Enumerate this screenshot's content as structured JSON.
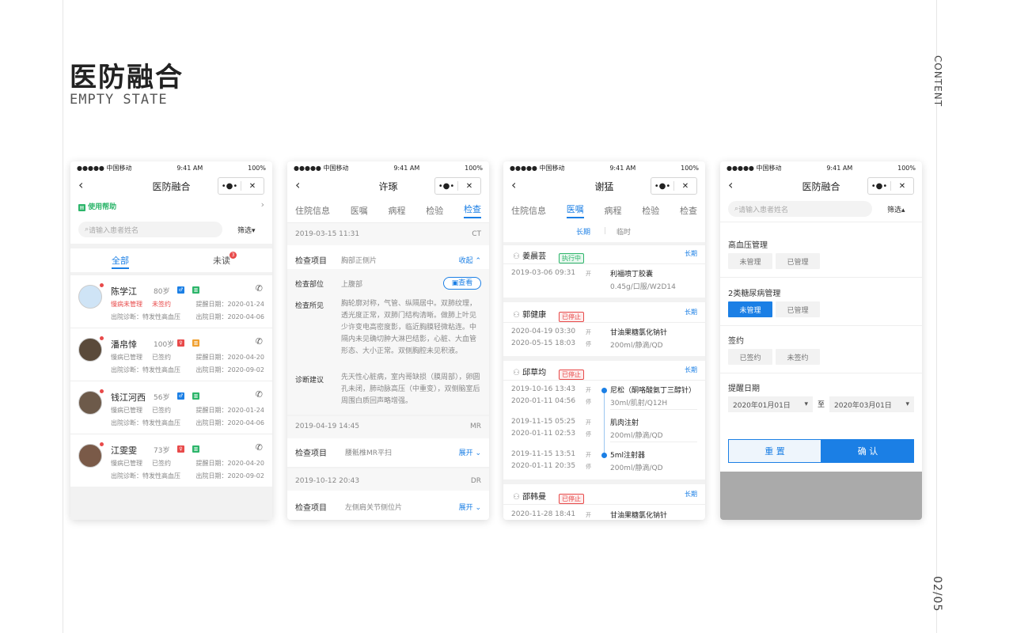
{
  "page": {
    "title": "医防融合",
    "subtitle": "EMPTY STATE",
    "side_top": "CONTENT",
    "side_bottom": "02/05"
  },
  "status": {
    "carrier": "●●●●● 中国移动",
    "time": "9:41 AM",
    "battery": "100%"
  },
  "colors": {
    "brand": "#1b7fe5",
    "green": "#2cb56a",
    "red": "#e84a4a"
  },
  "s1": {
    "nav_title": "医防融合",
    "help": "使用帮助",
    "search_placeholder": "请输入患者姓名",
    "filter": "筛选▾",
    "tab_all": "全部",
    "tab_unread": "未读",
    "unread_count": "3",
    "patients": [
      {
        "name": "陈学江",
        "age": "80岁",
        "tag1": "慢病未管理",
        "tag2": "未签约",
        "remind": "提醒日期：2020-01-24",
        "diag": "出院诊断：特发性高血压",
        "out": "出院日期：2020-04-06",
        "sex": "♂",
        "sexcolor": "#1b7fe5"
      },
      {
        "name": "潘帛悻",
        "age": "100岁",
        "tag1": "慢病已管理",
        "tag2": "已签约",
        "remind": "提醒日期：2020-04-20",
        "diag": "出院诊断：特发性高血压",
        "out": "出院日期：2020-09-02",
        "sex": "♀",
        "sexcolor": "#e84a4a"
      },
      {
        "name": "钱江河西",
        "age": "56岁",
        "tag1": "慢病已管理",
        "tag2": "已签约",
        "remind": "提醒日期：2020-01-24",
        "diag": "出院诊断：特发性高血压",
        "out": "出院日期：2020-04-06",
        "sex": "♂",
        "sexcolor": "#1b7fe5"
      },
      {
        "name": "江雯雯",
        "age": "73岁",
        "tag1": "慢病已管理",
        "tag2": "已签约",
        "remind": "提醒日期：2020-04-20",
        "diag": "出院诊断：特发性高血压",
        "out": "出院日期：2020-09-02",
        "sex": "♀",
        "sexcolor": "#e84a4a"
      }
    ]
  },
  "s2": {
    "nav_title": "许琢",
    "tabs": [
      "住院信息",
      "医嘱",
      "病程",
      "检验",
      "检查"
    ],
    "rec1": {
      "date": "2019-03-15  11:31",
      "type": "CT",
      "item_label": "检查项目",
      "item": "胸部正侧片",
      "collapse": "收起",
      "part_label": "检查部位",
      "part": "上腹部",
      "view": "查看",
      "find_label": "检查所见",
      "find": "胸轮廓对称，气管、纵隔居中。双肺纹理，透光度正常，双肺门结构清晰。做肺上叶见少许变电高密度影，临近胸膜轻微粘连。中隔内未见确切肿大淋巴结影，心脏、大血管形态、大小正常。双侧胸腔未见积液。",
      "advice_label": "诊断建议",
      "advice": "先天性心脏病，室内哥缺损（膜周部），卵圆孔未闭，肺动脉高压（中重变），双侧脑室后周围白质回声略增强。"
    },
    "rec2": {
      "date": "2019-04-19  14:45",
      "type": "MR",
      "item_label": "检查项目",
      "item": "腰骶椎MR平扫",
      "expand": "展开"
    },
    "rec3": {
      "date": "2019-10-12  20:43",
      "type": "DR",
      "item_label": "检查项目",
      "item": "左侧肩关节侧位片",
      "expand": "展开"
    }
  },
  "s3": {
    "nav_title": "谢猛",
    "tabs": [
      "住院信息",
      "医嘱",
      "病程",
      "检验",
      "检查"
    ],
    "sub_long": "长期",
    "sub_temp": "临时",
    "g1": {
      "name": "姜晨芸",
      "status": "执行中",
      "kind": "长期",
      "d1": "2019-03-06  09:31",
      "k1": "开",
      "drug": "利福喷丁胶囊",
      "dose": "0.45g/口服/W2D14"
    },
    "g2": {
      "name": "郭健康",
      "status": "已停止",
      "kind": "长期",
      "d1": "2020-04-19  03:30",
      "k1": "开",
      "d2": "2020-05-15  18:03",
      "k2": "停",
      "drug": "甘油果糖氯化钠针",
      "dose": "200ml/静滴/QD"
    },
    "g3": {
      "name": "邱草均",
      "status": "已停止",
      "kind": "长期",
      "items": [
        {
          "d1": "2019-10-16  13:43",
          "k1": "开",
          "d2": "2020-01-11  04:56",
          "k2": "停",
          "drug": "尼松（酮咯酸氨丁三醇针）",
          "dose": "30ml/肌射/Q12H"
        },
        {
          "d1": "2019-11-15  05:25",
          "k1": "开",
          "d2": "2020-01-11  02:53",
          "k2": "停",
          "drug": "肌肉注射",
          "dose": "200ml/静滴/QD"
        },
        {
          "d1": "2019-11-15  13:51",
          "k1": "开",
          "d2": "2020-01-11  20:35",
          "k2": "停",
          "drug": "5ml注射器",
          "dose": "200ml/静滴/QD"
        }
      ]
    },
    "g4": {
      "name": "邵韩曼",
      "status": "已停止",
      "kind": "长期",
      "d1": "2020-11-28  18:41",
      "k1": "开",
      "drug": "甘油果糖氯化钠针"
    }
  },
  "s4": {
    "nav_title": "医防融合",
    "search_placeholder": "请输入患者姓名",
    "filter": "筛选▴",
    "sec1": "高血压管理",
    "sec1_opts": [
      "未管理",
      "已管理"
    ],
    "sec2": "2类糖尿病管理",
    "sec2_opts": [
      "未管理",
      "已管理"
    ],
    "sec3": "签约",
    "sec3_opts": [
      "已签约",
      "未签约"
    ],
    "sec4": "提醒日期",
    "date_from": "2020年01月01日",
    "to": "至",
    "date_to": "2020年03月01日",
    "reset": "重 置",
    "confirm": "确 认"
  }
}
